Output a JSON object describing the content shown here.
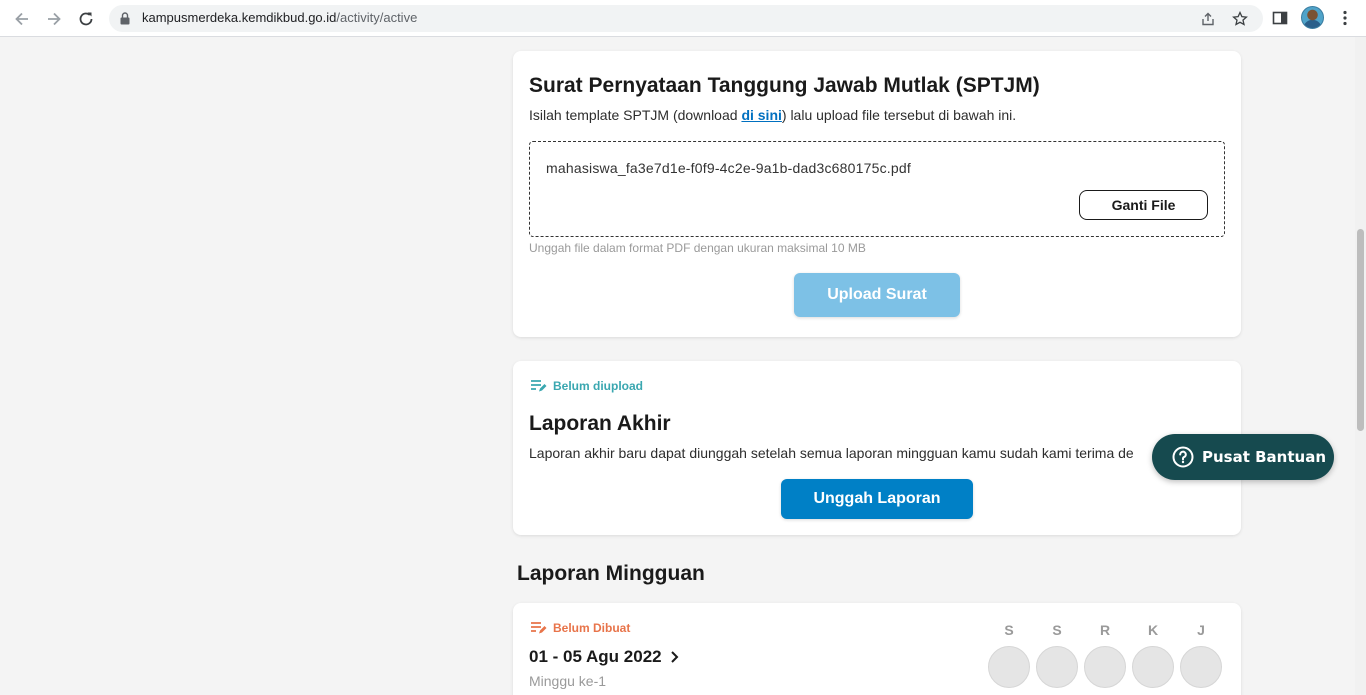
{
  "browser": {
    "url_host": "kampusmerdeka.kemdikbud.go.id",
    "url_path": "/activity/active"
  },
  "sptjm": {
    "title": "Surat Pernyataan Tanggung Jawab Mutlak (SPTJM)",
    "desc_before": "Isilah template SPTJM (download ",
    "desc_link": "di sini",
    "desc_after": ") lalu upload file tersebut di bawah ini.",
    "filename": "mahasiswa_fa3e7d1e-f0f9-4c2e-9a1b-dad3c680175c.pdf",
    "change_button": "Ganti File",
    "hint": "Unggah file dalam format PDF dengan ukuran maksimal 10 MB",
    "upload_button": "Upload Surat"
  },
  "final_report": {
    "status": "Belum diupload",
    "title": "Laporan Akhir",
    "desc": "Laporan akhir baru dapat diunggah setelah semua laporan mingguan kamu sudah kami terima de",
    "button": "Unggah Laporan"
  },
  "weekly": {
    "section_title": "Laporan Mingguan",
    "status": "Belum Dibuat",
    "date_range": "01 - 05 Agu 2022",
    "week_label": "Minggu ke-1",
    "days": [
      "S",
      "S",
      "R",
      "K",
      "J"
    ]
  },
  "help": {
    "label": "Pusat Bantuan"
  },
  "colors": {
    "primary": "#0080c6",
    "primary_disabled": "#7dc1e6",
    "status_teal": "#3aa7b0",
    "status_orange": "#e8744a",
    "help_bg": "#164a4f"
  }
}
